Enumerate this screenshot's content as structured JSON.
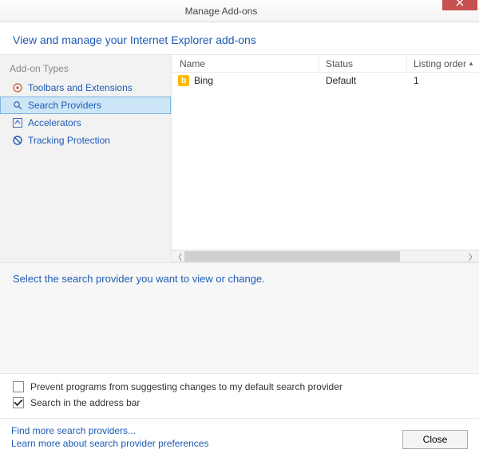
{
  "titlebar": {
    "title": "Manage Add-ons"
  },
  "header": {
    "text": "View and manage your Internet Explorer add-ons"
  },
  "sidebar": {
    "title": "Add-on Types",
    "items": [
      {
        "label": "Toolbars and Extensions"
      },
      {
        "label": "Search Providers"
      },
      {
        "label": "Accelerators"
      },
      {
        "label": "Tracking Protection"
      }
    ]
  },
  "columns": {
    "name": "Name",
    "status": "Status",
    "order": "Listing order"
  },
  "rows": [
    {
      "name": "Bing",
      "status": "Default",
      "order": "1"
    }
  ],
  "detail": {
    "title": "Select the search provider you want to view or change."
  },
  "checks": {
    "prevent": "Prevent programs from suggesting changes to my default search provider",
    "addressbar": "Search in the address bar"
  },
  "footer": {
    "find_more": "Find more search providers...",
    "learn_more": "Learn more about search provider preferences",
    "close": "Close"
  }
}
